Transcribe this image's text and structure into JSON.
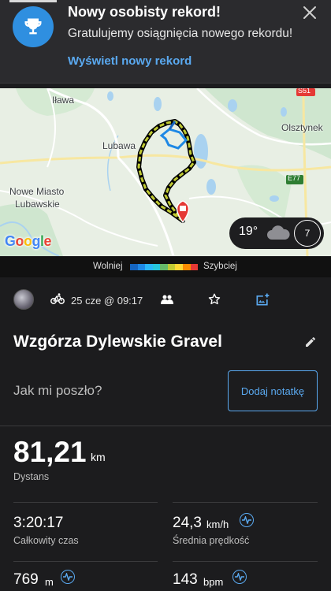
{
  "notification": {
    "title": "Nowy osobisty rekord!",
    "text": "Gratulujemy osiągnięcia nowego rekordu!",
    "link": "Wyświetl nowy rekord",
    "icon": "trophy-icon"
  },
  "map": {
    "places": [
      "Iława",
      "Lubawa",
      "Olsztynek",
      "Nowe Miasto",
      "Lubawskie",
      "S51",
      "E77"
    ],
    "attribution": "Google",
    "weather": {
      "temp": "19°",
      "condition": "cloud-icon",
      "wind": "7"
    }
  },
  "legend": {
    "slow": "Wolniej",
    "fast": "Szybciej",
    "colors": [
      "#1565c0",
      "#1e88e5",
      "#29b6f6",
      "#26c6da",
      "#66bb6a",
      "#c0ca33",
      "#fdd835",
      "#fb8c00",
      "#e53935"
    ]
  },
  "activity": {
    "date": "25 cze @ 09:17",
    "title": "Wzgórza Dylewskie Gravel",
    "how_question": "Jak mi poszło?",
    "add_note": "Dodaj notatkę"
  },
  "stats": {
    "distance": {
      "value": "81,21",
      "unit": "km",
      "label": "Dystans"
    },
    "total_time": {
      "value": "3:20:17",
      "label": "Całkowity czas"
    },
    "avg_speed": {
      "value": "24,3",
      "unit": "km/h",
      "label": "Średnia prędkość"
    },
    "elevation": {
      "value": "769",
      "unit": "m"
    },
    "heart_rate": {
      "value": "143",
      "unit": "bpm"
    }
  }
}
